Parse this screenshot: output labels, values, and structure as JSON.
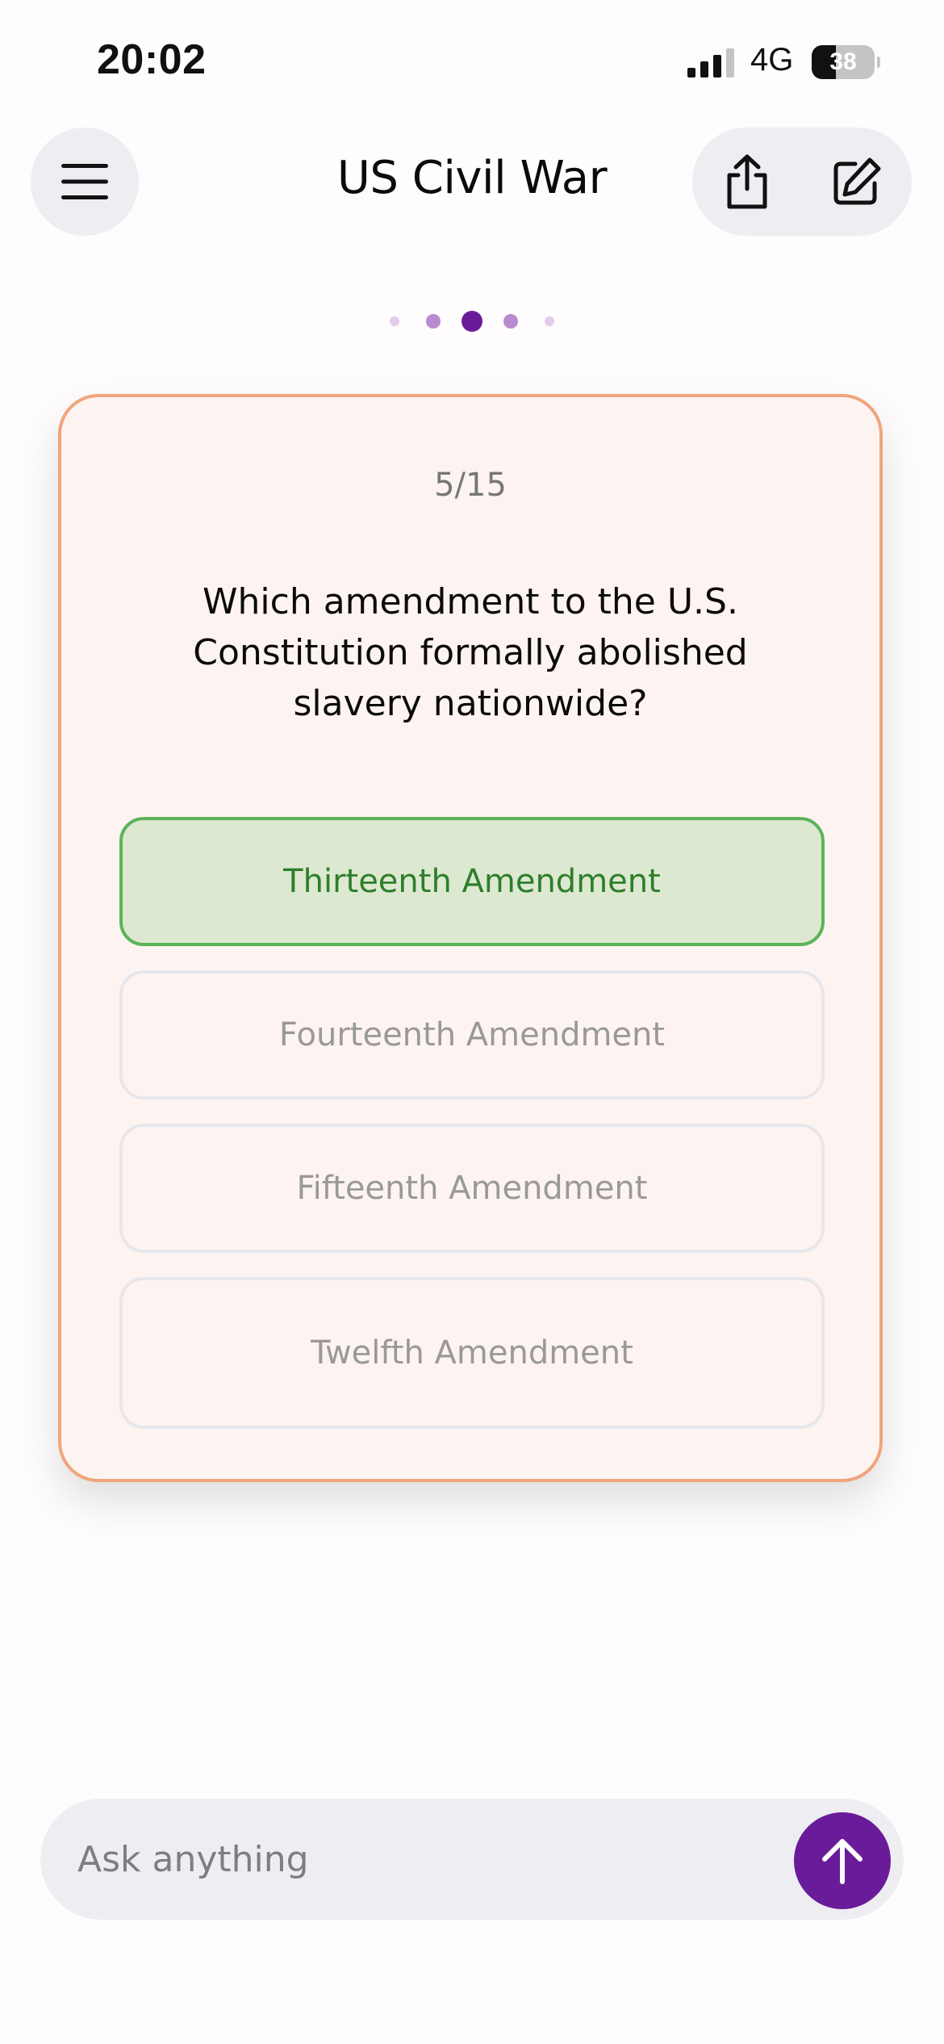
{
  "status_bar": {
    "time": "20:02",
    "network": "4G",
    "battery_percent": "38",
    "battery_level": 0.38,
    "signal_bars_active": 3
  },
  "header": {
    "title": "US Civil War"
  },
  "pager": {
    "total": 5,
    "active_index": 2,
    "colors": {
      "active": "#6a1b9a",
      "near": "#b98ccf",
      "far": "#e1cdea"
    }
  },
  "quiz": {
    "counter": "5/15",
    "question": "Which amendment to the U.S. Constitution formally abolished slavery nationwide?",
    "options": [
      {
        "label": "Thirteenth Amendment",
        "state": "correct"
      },
      {
        "label": "Fourteenth Amendment",
        "state": "dimmed"
      },
      {
        "label": "Fifteenth Amendment",
        "state": "dimmed"
      },
      {
        "label": "Twelfth Amendment",
        "state": "dimmed"
      }
    ]
  },
  "ask": {
    "placeholder": "Ask anything"
  },
  "colors": {
    "accent": "#6a1b9a",
    "card_border": "#f0a57c",
    "card_bg": "#fdf4f1",
    "correct_border": "#5cb35a",
    "correct_bg": "#dde8d1",
    "correct_text": "#2d7f2b"
  },
  "icons": {
    "menu": "hamburger-menu-icon",
    "share": "share-icon",
    "edit": "edit-icon",
    "send": "arrow-up-icon"
  }
}
